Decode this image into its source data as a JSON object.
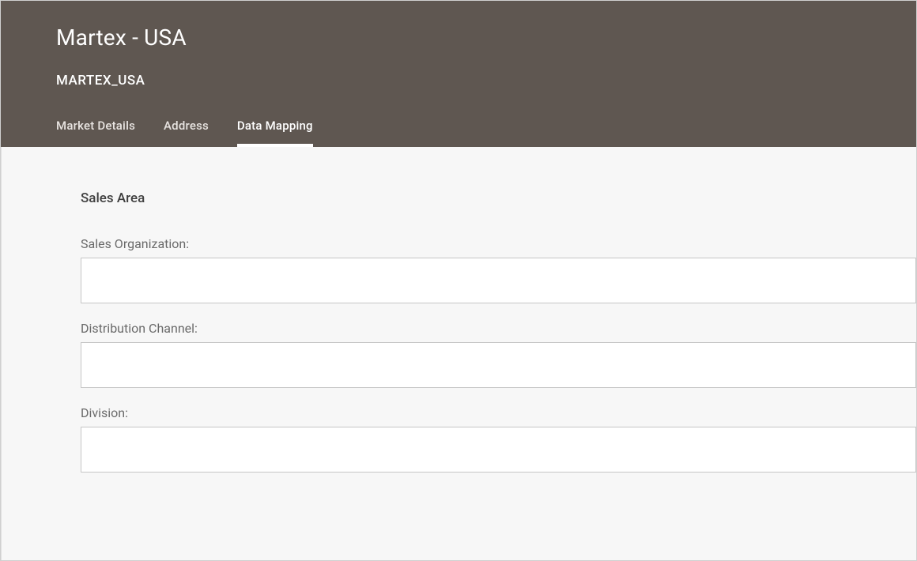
{
  "header": {
    "title": "Martex - USA",
    "subtitle": "MARTEX_USA",
    "tabs": [
      {
        "label": "Market Details",
        "active": false
      },
      {
        "label": "Address",
        "active": false
      },
      {
        "label": "Data Mapping",
        "active": true
      }
    ]
  },
  "content": {
    "section_title": "Sales Area",
    "fields": {
      "sales_organization": {
        "label": "Sales Organization:",
        "value": ""
      },
      "distribution_channel": {
        "label": "Distribution Channel:",
        "value": ""
      },
      "division": {
        "label": "Division:",
        "value": ""
      }
    }
  }
}
